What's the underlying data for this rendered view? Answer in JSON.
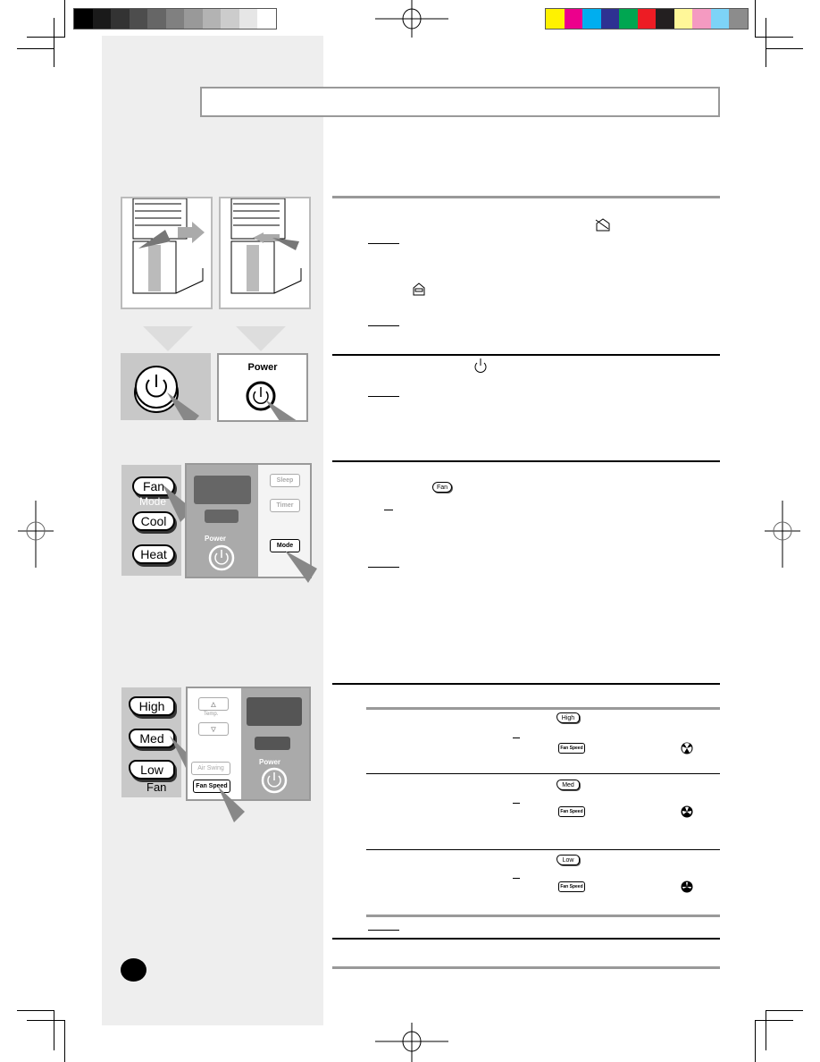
{
  "page": {
    "kind": "printed appliance manual page (text content not rendered)",
    "page_number_badge": ""
  },
  "printer_marks": {
    "grayscale_swatches": [
      "#000000",
      "#1a1a1a",
      "#333333",
      "#4d4d4d",
      "#666666",
      "#808080",
      "#999999",
      "#b3b3b3",
      "#cccccc",
      "#e6e6e6",
      "#ffffff"
    ],
    "color_swatches": [
      "#fff200",
      "#ec008c",
      "#00aeef",
      "#2e3192",
      "#00a651",
      "#ed1c24",
      "#231f20",
      "#fff799",
      "#f49ac1",
      "#7dd3f7",
      "#8c8c8c"
    ]
  },
  "title_bar": {
    "text": ""
  },
  "illustrations": {
    "unit_step": {
      "arrow_directions": [
        "right",
        "left"
      ]
    },
    "power_step": {
      "power_label": "Power"
    },
    "mode_step": {
      "remote_buttons": [
        "Fan",
        "Cool",
        "Heat"
      ],
      "remote_group_label": "Mode",
      "panel_buttons": [
        "Sleep",
        "Timer",
        "Mode"
      ],
      "panel_power_label": "Power"
    },
    "fan_step": {
      "remote_buttons": [
        "High",
        "Med",
        "Low"
      ],
      "remote_group_label": "Fan",
      "temp_label": "Temp.",
      "air_swing_label": "Air Swing",
      "fan_speed_label": "Fan Speed",
      "panel_power_label": "Power"
    }
  },
  "inline_icons": {
    "fan_button": "Fan",
    "fan_speed_table": [
      {
        "remote_button": "High",
        "panel_button": "Fan Speed",
        "indicator": "fan-high-icon"
      },
      {
        "remote_button": "Med",
        "panel_button": "Fan Speed",
        "indicator": "fan-med-icon"
      },
      {
        "remote_button": "Low",
        "panel_button": "Fan Speed",
        "indicator": "fan-low-icon"
      }
    ]
  },
  "colors": {
    "sidebar_bg": "#eeeeee",
    "rule_gray": "#999999",
    "panel_gray": "#aaaaaa"
  }
}
